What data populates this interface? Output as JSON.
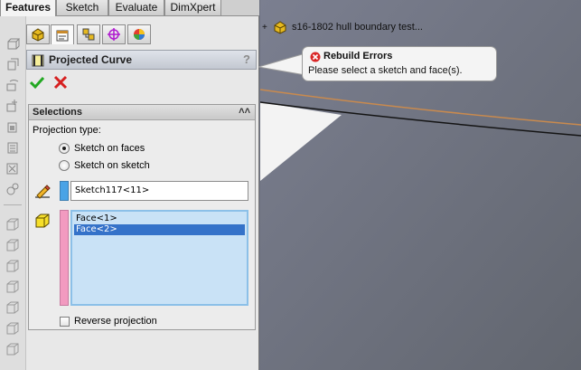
{
  "command_tabs": [
    {
      "label": "Features",
      "active": true
    },
    {
      "label": "Sketch",
      "active": false
    },
    {
      "label": "Evaluate",
      "active": false
    },
    {
      "label": "DimXpert",
      "active": false
    }
  ],
  "manager_tabs": [
    {
      "icon": "feature-manager-icon",
      "active": false
    },
    {
      "icon": "property-manager-icon",
      "active": true
    },
    {
      "icon": "configuration-manager-icon",
      "active": false
    },
    {
      "icon": "dimxpert-manager-icon",
      "active": false
    },
    {
      "icon": "display-manager-icon",
      "active": false
    }
  ],
  "toolstrip_icons": [
    "extrude-icon",
    "revolve-icon",
    "sweep-icon",
    "loft-icon",
    "fillet-icon",
    "pattern-icon",
    "rib-icon",
    "shell-icon",
    "reference-geometry-icon",
    "cube-1-icon",
    "cube-2-icon",
    "cube-3-icon",
    "cube-4-icon",
    "cube-5-icon",
    "cube-6-icon",
    "cube-7-icon"
  ],
  "property_manager": {
    "title": "Projected Curve",
    "help": "?",
    "ok_icon": "checkmark-icon",
    "cancel_icon": "x-icon"
  },
  "selections": {
    "title": "Selections",
    "collapse": "˄˄",
    "projection_type_label": "Projection type:",
    "options": [
      {
        "label": "Sketch on faces",
        "checked": true
      },
      {
        "label": "Sketch on sketch",
        "checked": false
      }
    ],
    "sketch_value": "Sketch117<11>",
    "sketch_color": "#4aa3e6",
    "faces": [
      {
        "label": "Face<1>",
        "selected": false
      },
      {
        "label": "Face<2>",
        "selected": true
      }
    ],
    "faces_color": "#f29ac0",
    "reverse_label": "Reverse projection",
    "reverse_checked": false
  },
  "viewport": {
    "tree_expand": "+",
    "part_name": "s16-1802 hull boundary test...",
    "error_title": "Rebuild Errors",
    "error_message": "Please select a sketch and face(s)."
  }
}
